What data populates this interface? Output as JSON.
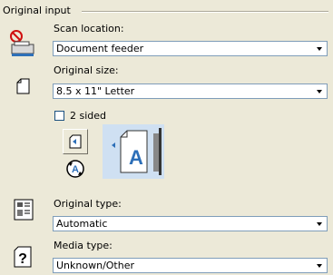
{
  "group": {
    "title": "Original input"
  },
  "scan_location": {
    "label": "Scan location:",
    "value": "Document feeder"
  },
  "original_size": {
    "label": "Original size:",
    "value": "8.5 x 11\" Letter"
  },
  "two_sided": {
    "label": "2 sided",
    "checked": false
  },
  "original_type": {
    "label": "Original type:",
    "value": "Automatic"
  },
  "media_type": {
    "label": "Media type:",
    "value": "Unknown/Other"
  },
  "preview": {
    "glyph": "A"
  },
  "icons": {
    "scanner": "scanner-icon",
    "page_size": "page-size-icon",
    "original_type": "original-type-icon",
    "media_type": "help-question-icon",
    "flip": "flip-page-icon",
    "rotate": "rotate-page-icon"
  },
  "colors": {
    "background": "#ece9d8",
    "field_border": "#7f9db9",
    "preview_blue": "#2d6fb8",
    "accent_red": "#d01010"
  }
}
